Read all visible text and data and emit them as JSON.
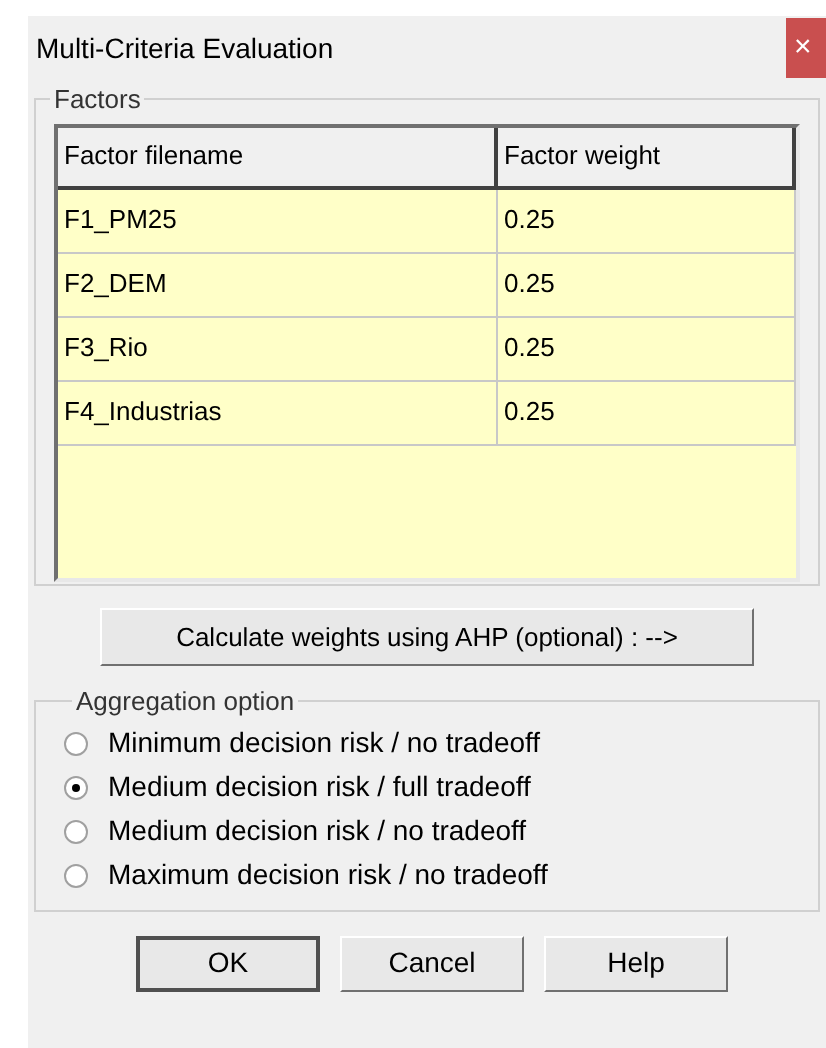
{
  "window": {
    "title": "Multi-Criteria Evaluation",
    "close": "×"
  },
  "factors": {
    "label": "Factors",
    "columns": [
      "Factor filename",
      "Factor weight"
    ],
    "rows": [
      [
        "F1_PM25",
        "0.25"
      ],
      [
        "F2_DEM",
        "0.25"
      ],
      [
        "F3_Rio",
        "0.25"
      ],
      [
        "F4_Industrias",
        "0.25"
      ]
    ]
  },
  "ahp_button": "Calculate weights using AHP (optional) :  -->",
  "aggregation": {
    "label": "Aggregation option",
    "options": [
      {
        "label": "Minimum decision risk / no tradeoff",
        "selected": false
      },
      {
        "label": "Medium decision risk / full tradeoff",
        "selected": true
      },
      {
        "label": "Medium decision risk / no tradeoff",
        "selected": false
      },
      {
        "label": "Maximum decision risk / no tradeoff",
        "selected": false
      }
    ]
  },
  "buttons": [
    {
      "label": "OK",
      "default": true
    },
    {
      "label": "Cancel",
      "default": false
    },
    {
      "label": "Help",
      "default": false
    }
  ]
}
